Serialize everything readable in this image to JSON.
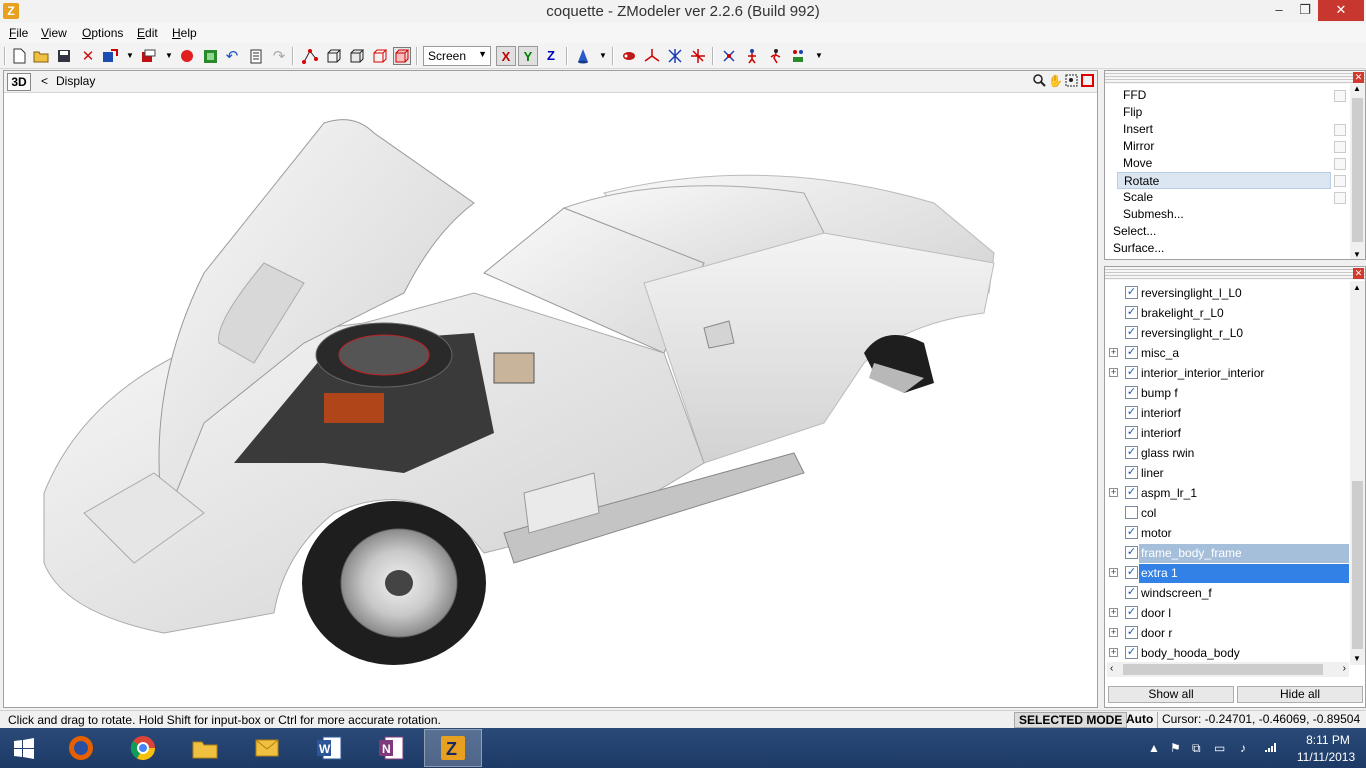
{
  "window": {
    "app_icon": "Z",
    "title": "coquette - ZModeler ver 2.2.6 (Build 992)",
    "minimize": "–",
    "maximize": "❐",
    "close": "✕"
  },
  "menu": [
    "File",
    "View",
    "Options",
    "Edit",
    "Help"
  ],
  "toolbar": {
    "icons": [
      "new-icon",
      "open-icon",
      "save-icon",
      "delete-icon",
      "import-icon",
      "export-icon",
      "record-icon",
      "render-icon",
      "undo-icon",
      "properties-icon",
      "redo-icon",
      "select-vertex-icon",
      "select-box-icon",
      "select-group-icon",
      "select-object-icon",
      "select-polygon-icon"
    ],
    "coord_system": "Screen",
    "axis_x": "X",
    "axis_y": "Y",
    "axis_z": "Z",
    "axis_colors": {
      "x": "#c00000",
      "y": "#008000",
      "z": "#0000c0"
    }
  },
  "viewport": {
    "mode_button": "3D",
    "back": "<",
    "label": "Display"
  },
  "modifiers": {
    "items": [
      "FFD",
      "Flip",
      "Insert",
      "Mirror",
      "Move",
      "Rotate",
      "Scale",
      "Submesh...",
      "Select...",
      "Surface..."
    ],
    "selected": "Rotate"
  },
  "objects": {
    "rows": [
      {
        "label": "reversinglight_l_L0",
        "checked": true,
        "expand": false
      },
      {
        "label": "brakelight_r_L0",
        "checked": true,
        "expand": false
      },
      {
        "label": "reversinglight_r_L0",
        "checked": true,
        "expand": false
      },
      {
        "label": "misc_a",
        "checked": true,
        "expand": true
      },
      {
        "label": "interior_interior_interior",
        "checked": true,
        "expand": true
      },
      {
        "label": "bump f",
        "checked": true,
        "expand": false
      },
      {
        "label": "interiorf",
        "checked": true,
        "expand": false
      },
      {
        "label": "interiorf",
        "checked": true,
        "expand": false
      },
      {
        "label": "glass rwin",
        "checked": true,
        "expand": false
      },
      {
        "label": "liner",
        "checked": true,
        "expand": false
      },
      {
        "label": "aspm_lr_1",
        "checked": true,
        "expand": true
      },
      {
        "label": "col",
        "checked": false,
        "expand": false
      },
      {
        "label": "motor",
        "checked": true,
        "expand": false
      },
      {
        "label": "frame_body_frame",
        "checked": true,
        "expand": false
      },
      {
        "label": "extra 1",
        "checked": true,
        "expand": true
      },
      {
        "label": "windscreen_f",
        "checked": true,
        "expand": false
      },
      {
        "label": "door l",
        "checked": true,
        "expand": true
      },
      {
        "label": "door r",
        "checked": true,
        "expand": true
      },
      {
        "label": "body_hooda_body",
        "checked": true,
        "expand": true
      }
    ],
    "show_all": "Show all",
    "hide_all": "Hide all"
  },
  "status": {
    "message": "Click and drag to rotate. Hold Shift for input-box or Ctrl for more accurate rotation.",
    "mode": "SELECTED MODE",
    "auto": "Auto",
    "cursor": "Cursor: -0.24701, -0.46069, -0.89504"
  },
  "taskbar": {
    "apps": [
      "windows-start-icon",
      "firefox-icon",
      "chrome-icon",
      "file-explorer-icon",
      "outlook-icon",
      "word-icon",
      "onenote-icon",
      "zmodeler-icon"
    ],
    "time": "8:11 PM",
    "date": "11/11/2013"
  }
}
